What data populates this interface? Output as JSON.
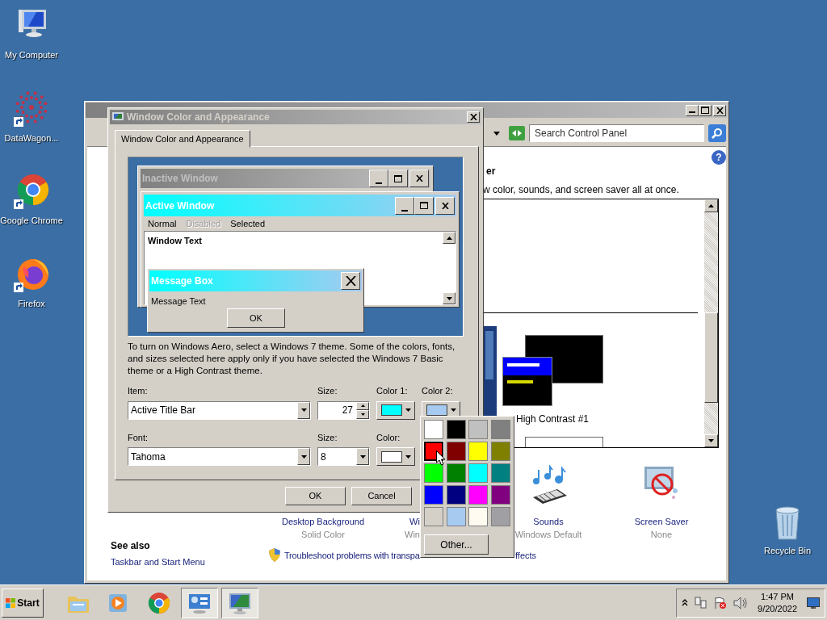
{
  "desktop_icons": [
    {
      "label": "My Computer",
      "kind": "computer"
    },
    {
      "label": "DataWagon...",
      "kind": "dots"
    },
    {
      "label": "Google Chrome",
      "kind": "chrome"
    },
    {
      "label": "Firefox",
      "kind": "firefox"
    }
  ],
  "recycle_bin": {
    "label": "Recycle Bin"
  },
  "control_panel": {
    "search": {
      "placeholder": "Search Control Panel"
    },
    "help": "?",
    "heading_fragment": "er",
    "description_fragment": "w color, sounds, and screen saver all at once.",
    "themes": [
      {
        "label": "High Contrast #1"
      }
    ],
    "settings": [
      {
        "label": "Desktop Background",
        "value": "Solid Color",
        "kind": "background"
      },
      {
        "label": "Wi",
        "value": "Win",
        "kind": "window"
      },
      {
        "label": "Sounds",
        "value": "Windows Default",
        "kind": "sounds"
      },
      {
        "label": "Screen Saver",
        "value": "None",
        "kind": "screensaver"
      }
    ],
    "see_also": {
      "title": "See also",
      "links": [
        "Taskbar and Start Menu"
      ]
    },
    "troubleshoot": {
      "text": "Troubleshoot problems with transpa",
      "tail": "ffects"
    }
  },
  "dialog": {
    "title": "Window Color and Appearance",
    "tabs": [
      {
        "label": "Window Color and Appearance",
        "selected": true
      }
    ],
    "preview": {
      "inactive_title": "Inactive Window",
      "active_title": "Active Window",
      "menu": [
        {
          "label": "Normal",
          "kind": "normal"
        },
        {
          "label": "Disabled",
          "kind": "disabled"
        },
        {
          "label": "Selected",
          "kind": "selected"
        }
      ],
      "window_text": "Window Text",
      "message_title": "Message Box",
      "message_text": "Message Text",
      "ok": "OK"
    },
    "info": "To turn on Windows Aero, select a Windows 7 theme.  Some of the colors, fonts, and sizes selected here apply only if you have selected the Windows 7 Basic theme or a High Contrast theme.",
    "item": {
      "label": "Item:",
      "value": "Active Title Bar"
    },
    "item_size": {
      "label": "Size:",
      "value": "27"
    },
    "color1": {
      "label": "Color 1:",
      "color": "#00ffff"
    },
    "color2": {
      "label": "Color 2:",
      "color": "#a6caf0"
    },
    "font": {
      "label": "Font:",
      "value": "Tahoma"
    },
    "font_size": {
      "label": "Size:",
      "value": "8"
    },
    "font_color": {
      "label": "Color:",
      "color": "#ffffff"
    },
    "buttons": [
      "OK",
      "Cancel"
    ]
  },
  "color_popup": {
    "swatches": [
      {
        "color": "#ffffff",
        "selected": false
      },
      {
        "color": "#000000",
        "selected": false
      },
      {
        "color": "#c0c0c0",
        "selected": false
      },
      {
        "color": "#808080",
        "selected": false
      },
      {
        "color": "#ff0000",
        "selected": true
      },
      {
        "color": "#800000",
        "selected": false
      },
      {
        "color": "#ffff00",
        "selected": false
      },
      {
        "color": "#808000",
        "selected": false
      },
      {
        "color": "#00ff00",
        "selected": false
      },
      {
        "color": "#008000",
        "selected": false
      },
      {
        "color": "#00ffff",
        "selected": false
      },
      {
        "color": "#008080",
        "selected": false
      },
      {
        "color": "#0000ff",
        "selected": false
      },
      {
        "color": "#000080",
        "selected": false
      },
      {
        "color": "#ff00ff",
        "selected": false
      },
      {
        "color": "#800080",
        "selected": false
      },
      {
        "color": "#d4d0c8",
        "selected": false
      },
      {
        "color": "#a6caf0",
        "selected": false
      },
      {
        "color": "#fffbf0",
        "selected": false
      },
      {
        "color": "#a0a0a4",
        "selected": false
      }
    ],
    "other_button": "Other..."
  },
  "taskbar": {
    "start": "Start",
    "apps": [
      {
        "kind": "folder",
        "selected": false
      },
      {
        "kind": "media",
        "selected": false
      },
      {
        "kind": "chrome",
        "selected": false
      },
      {
        "kind": "controlpanel",
        "selected": true
      },
      {
        "kind": "display",
        "selected": true
      }
    ],
    "clock": {
      "time": "1:47 PM",
      "date": "9/20/2022"
    }
  }
}
